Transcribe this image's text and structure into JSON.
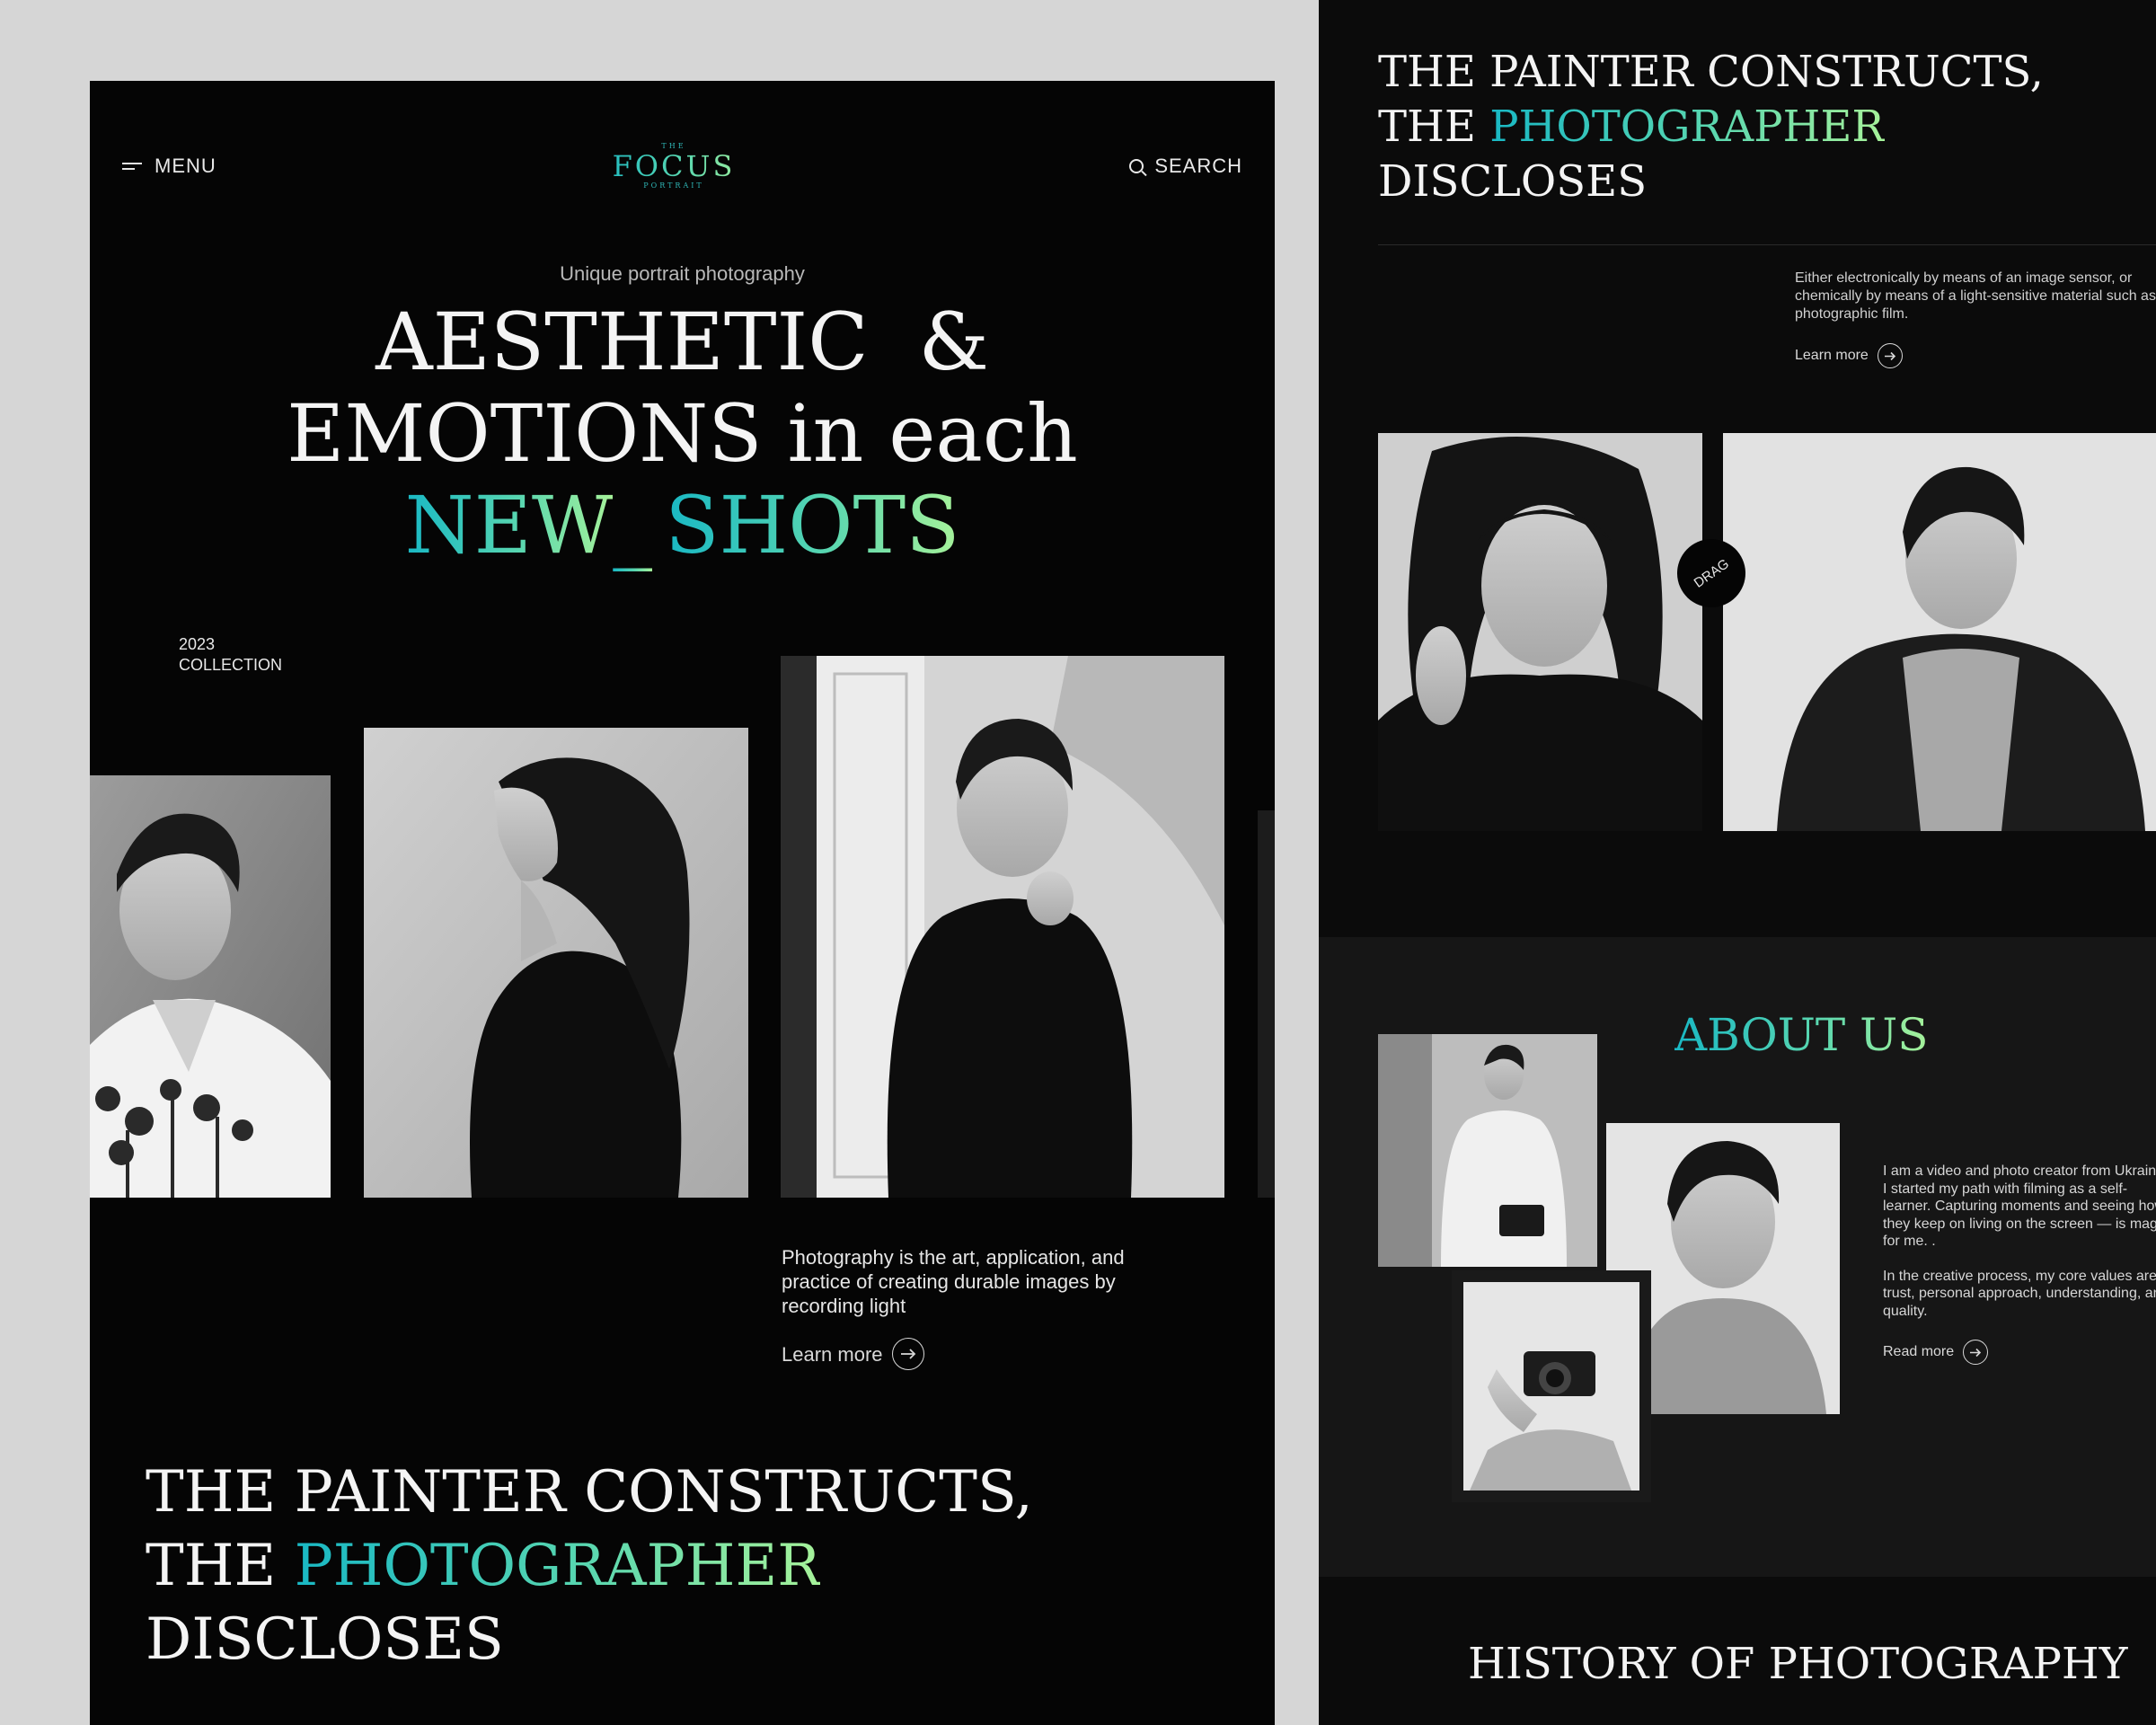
{
  "colors": {
    "accent_start": "#19b8c4",
    "accent_end": "#a6f29a",
    "background": "#050505",
    "page_bg": "#d6d6d6"
  },
  "icons": {
    "menu": "hamburger-icon",
    "search": "search-icon",
    "learn_more": "arrow-right-circle-icon"
  },
  "nav": {
    "menu_label": "MENU",
    "search_label": "SEARCH"
  },
  "logo": {
    "small_top": "THE",
    "main": "FOCUS",
    "small_bottom": "PORTRAIT"
  },
  "hero": {
    "subtitle": "Unique portrait photography",
    "line1": "AESTHETIC  &",
    "line2": "EMOTIONS in each",
    "line3_part1": "NEW",
    "line3_underscore": "_",
    "line3_part2": "SHOTS"
  },
  "collection": {
    "year": "2023",
    "label": "COLLECTION"
  },
  "intro": {
    "text": "Photography is the art, application, and practice of creating durable images by recording light",
    "link": "Learn more"
  },
  "painter_section": {
    "line1": "THE PAINTER CONSTRUCTS,",
    "line2_prefix": "THE",
    "line2_accent": "PHOTOGRAPHER",
    "line3": "DISCLOSES"
  },
  "right_intro": {
    "text": "Either electronically by means of an image sensor, or chemically by means of a light-sensitive material such as photographic film.",
    "link": "Learn more"
  },
  "drag_label": "DRAG",
  "about": {
    "title": "ABOUT US",
    "p1": "I am a video and photo creator from Ukraine. I started my path with filming as a self-learner. Capturing moments and seeing how they keep on living on the screen — is magic for me. .",
    "p2": "In the creative process, my core values are trust, personal approach, understanding, and quality.",
    "link": "Read more"
  },
  "history_title": "HISTORY OF PHOTOGRAPHY"
}
